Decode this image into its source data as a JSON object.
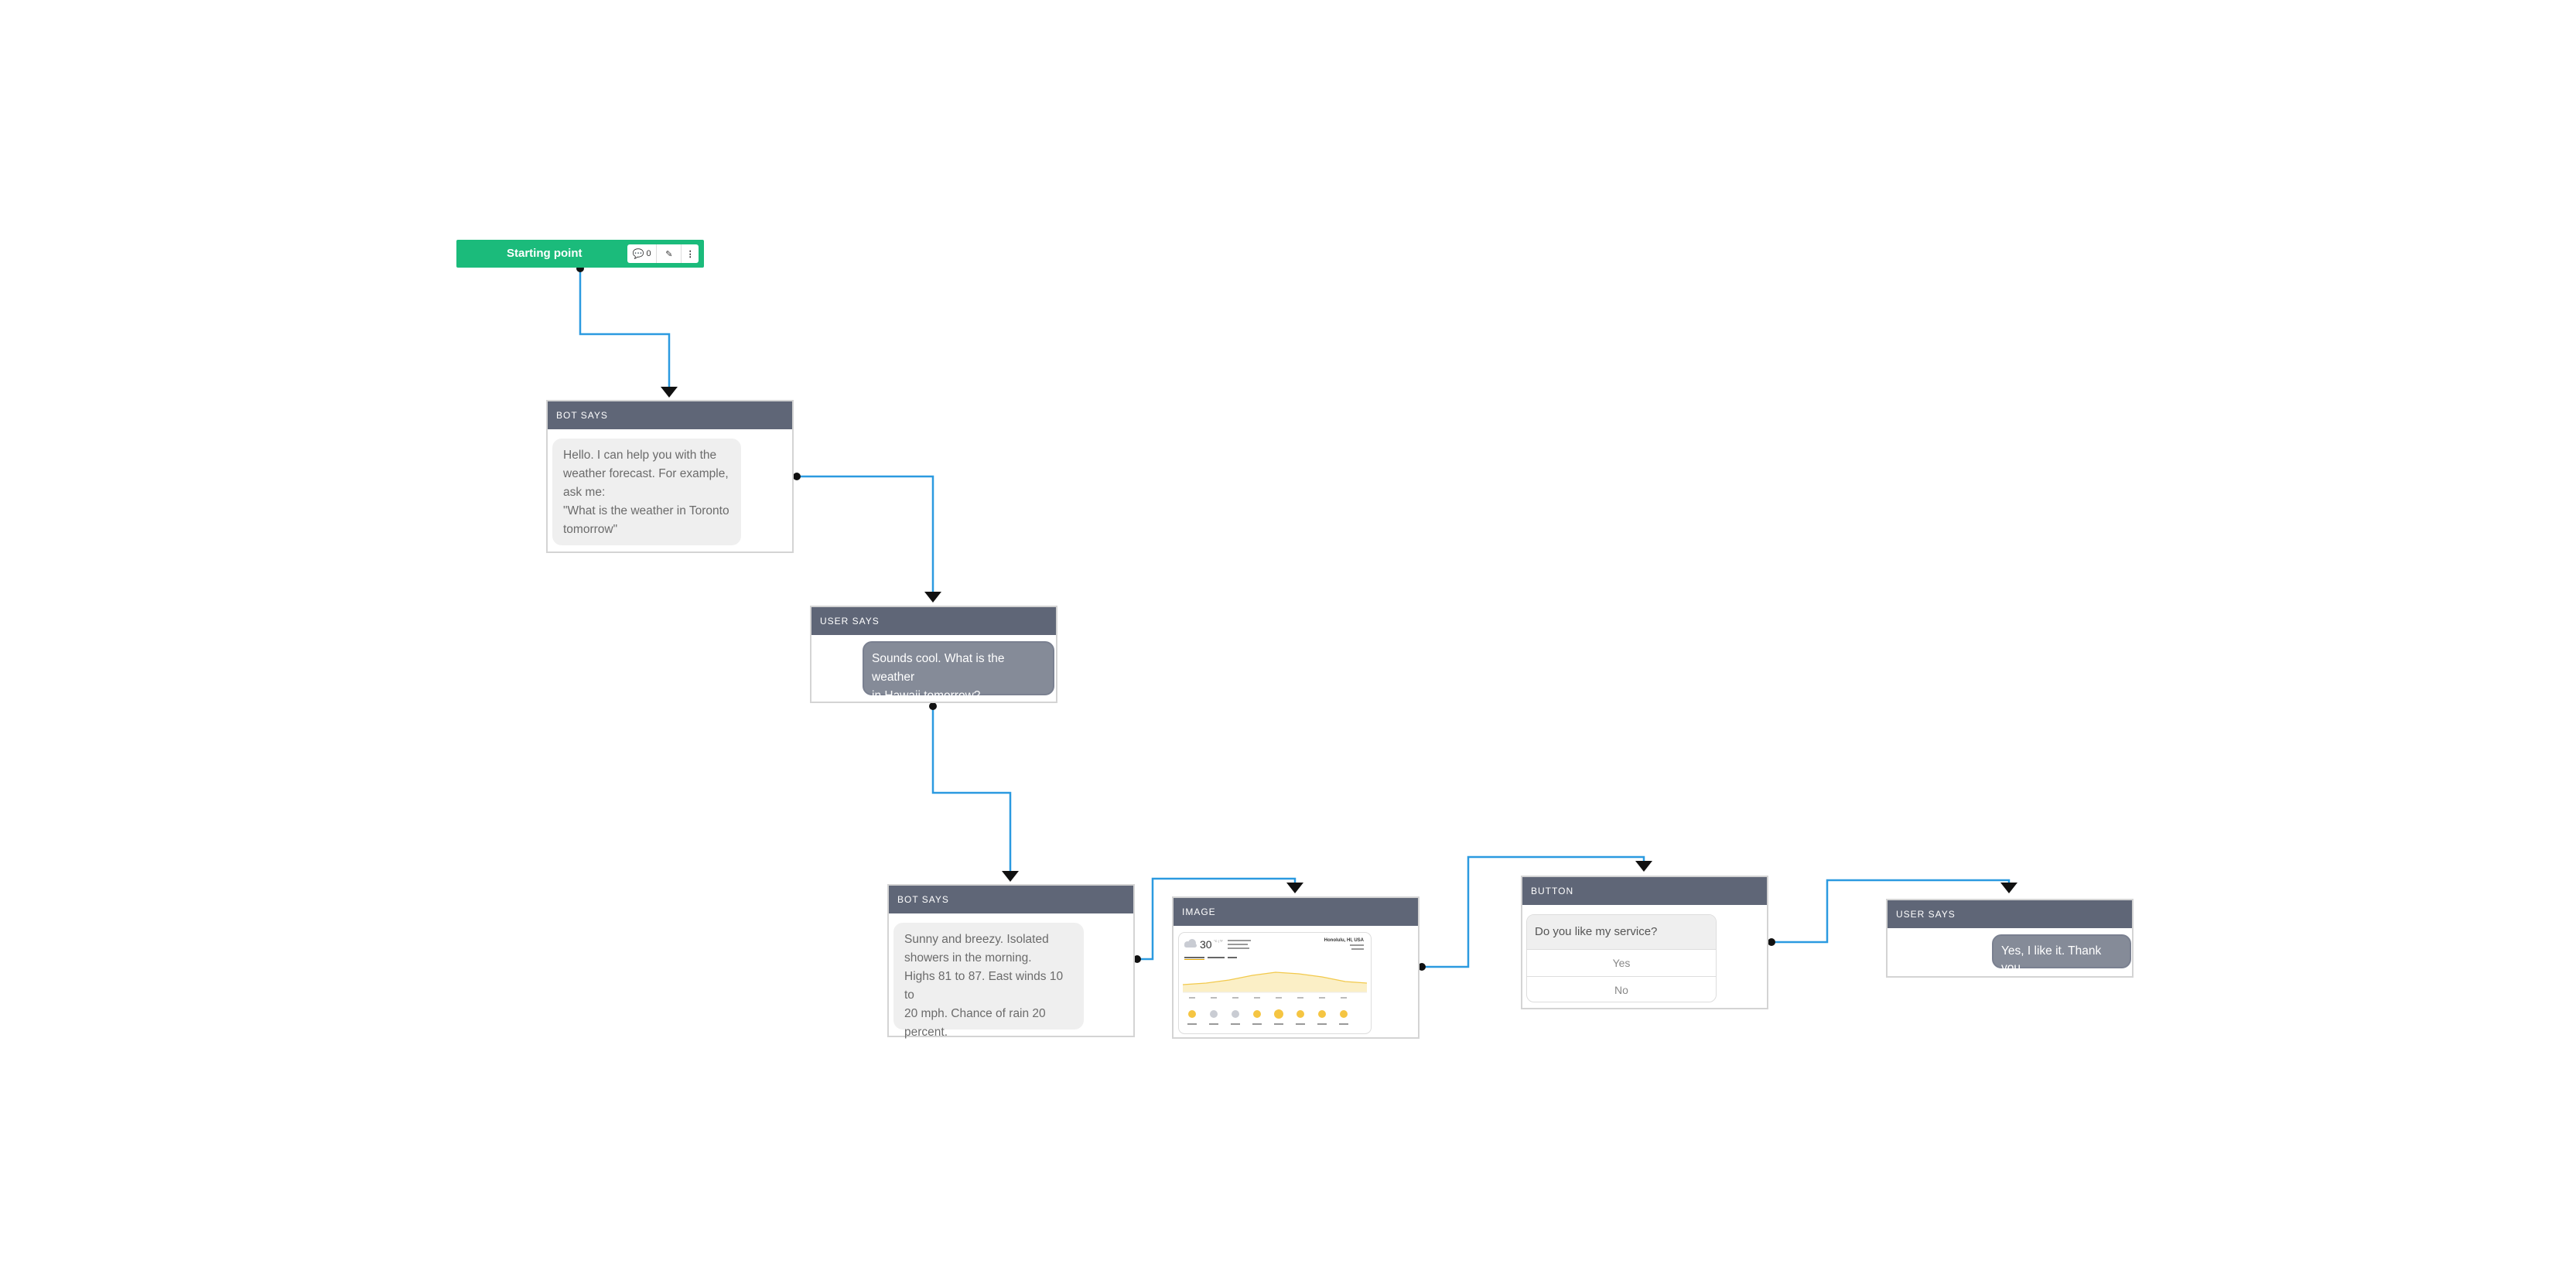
{
  "start": {
    "label": "Starting point",
    "comment_count": "0"
  },
  "icons": {
    "comment": "comment-icon",
    "edit": "edit-icon",
    "menu": "vertical-dots-icon"
  },
  "colors": {
    "connector": "#2b9ae0",
    "start": "#1bbb7b",
    "header": "#5f6677",
    "bot_bubble": "#efefef",
    "user_bubble": "#858b98"
  },
  "nodes": {
    "bot1": {
      "type": "BOT SAYS",
      "lines": [
        "Hello. I can help you with the",
        "weather forecast. For example,",
        "ask me:",
        "\"What is the weather in Toronto",
        "tomorrow\""
      ]
    },
    "user1": {
      "type": "USER SAYS",
      "lines": [
        "Sounds cool. What is the weather",
        "in Hawaii tomorrow?"
      ]
    },
    "bot2": {
      "type": "BOT SAYS",
      "lines": [
        "Sunny and breezy. Isolated",
        "showers in the morning.",
        "Highs 81 to 87. East winds 10 to",
        "20 mph. Chance of rain 20",
        "percent."
      ]
    },
    "image": {
      "type": "IMAGE",
      "weather": {
        "temp": "30",
        "unit": "°C | °F",
        "location": "Honolulu, HI, USA"
      }
    },
    "button": {
      "type": "BUTTON",
      "question": "Do you like my service?",
      "options": [
        "Yes",
        "No"
      ]
    },
    "user2": {
      "type": "USER SAYS",
      "text": "Yes, I like it. Thank you."
    }
  }
}
